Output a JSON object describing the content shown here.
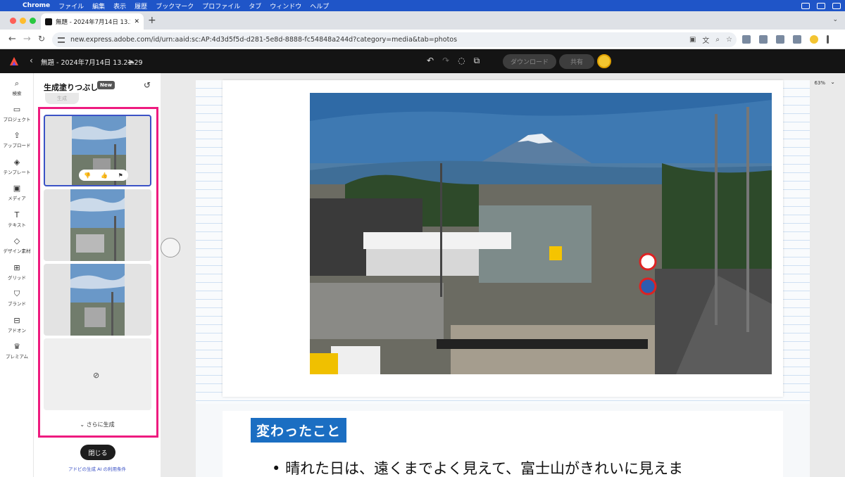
{
  "os_menubar": {
    "app_name": "Chrome",
    "items": [
      "ファイル",
      "編集",
      "表示",
      "履歴",
      "ブックマーク",
      "プロファイル",
      "タブ",
      "ウィンドウ",
      "ヘルプ"
    ]
  },
  "browser": {
    "tab_title": "無題 - 2024年7月14日 13.21.29",
    "url": "new.express.adobe.com/id/urn:aaid:sc:AP:4d3d5f5d-d281-5e8d-8888-fc54848a244d?category=media&tab=photos"
  },
  "app_header": {
    "doc_title": "無題 - 2024年7月14日 13.21.29",
    "download_label": "ダウンロード",
    "share_label": "共有"
  },
  "rail": {
    "items": [
      {
        "label": "検索",
        "icon": "search-icon"
      },
      {
        "label": "プロジェクト",
        "icon": "folder-icon"
      },
      {
        "label": "アップロード",
        "icon": "upload-icon"
      },
      {
        "label": "テンプレート",
        "icon": "template-icon"
      },
      {
        "label": "メディア",
        "icon": "media-icon"
      },
      {
        "label": "テキスト",
        "icon": "text-icon"
      },
      {
        "label": "デザイン素材",
        "icon": "shapes-icon"
      },
      {
        "label": "グリッド",
        "icon": "grid-icon"
      },
      {
        "label": "ブランド",
        "icon": "brand-icon"
      },
      {
        "label": "アドオン",
        "icon": "addon-icon"
      },
      {
        "label": "プレミアム",
        "icon": "crown-icon"
      }
    ]
  },
  "panel": {
    "title": "生成塗りつぶし",
    "new_badge": "New",
    "generate_label": "生成",
    "more_label": "さらに生成",
    "close_label": "閉じる",
    "terms_label": "アドビの生成 AI の利用条件"
  },
  "canvas": {
    "zoom": "63%",
    "heading": "変わったこと",
    "bullet": "晴れた日は、遠くまでよく見えて、富士山がきれいに見えま"
  },
  "colors": {
    "highlight": "#ee1b7f",
    "selected_border": "#3b52c6",
    "heading_bg": "#1b6ec2",
    "menubar": "#1f55c8"
  }
}
